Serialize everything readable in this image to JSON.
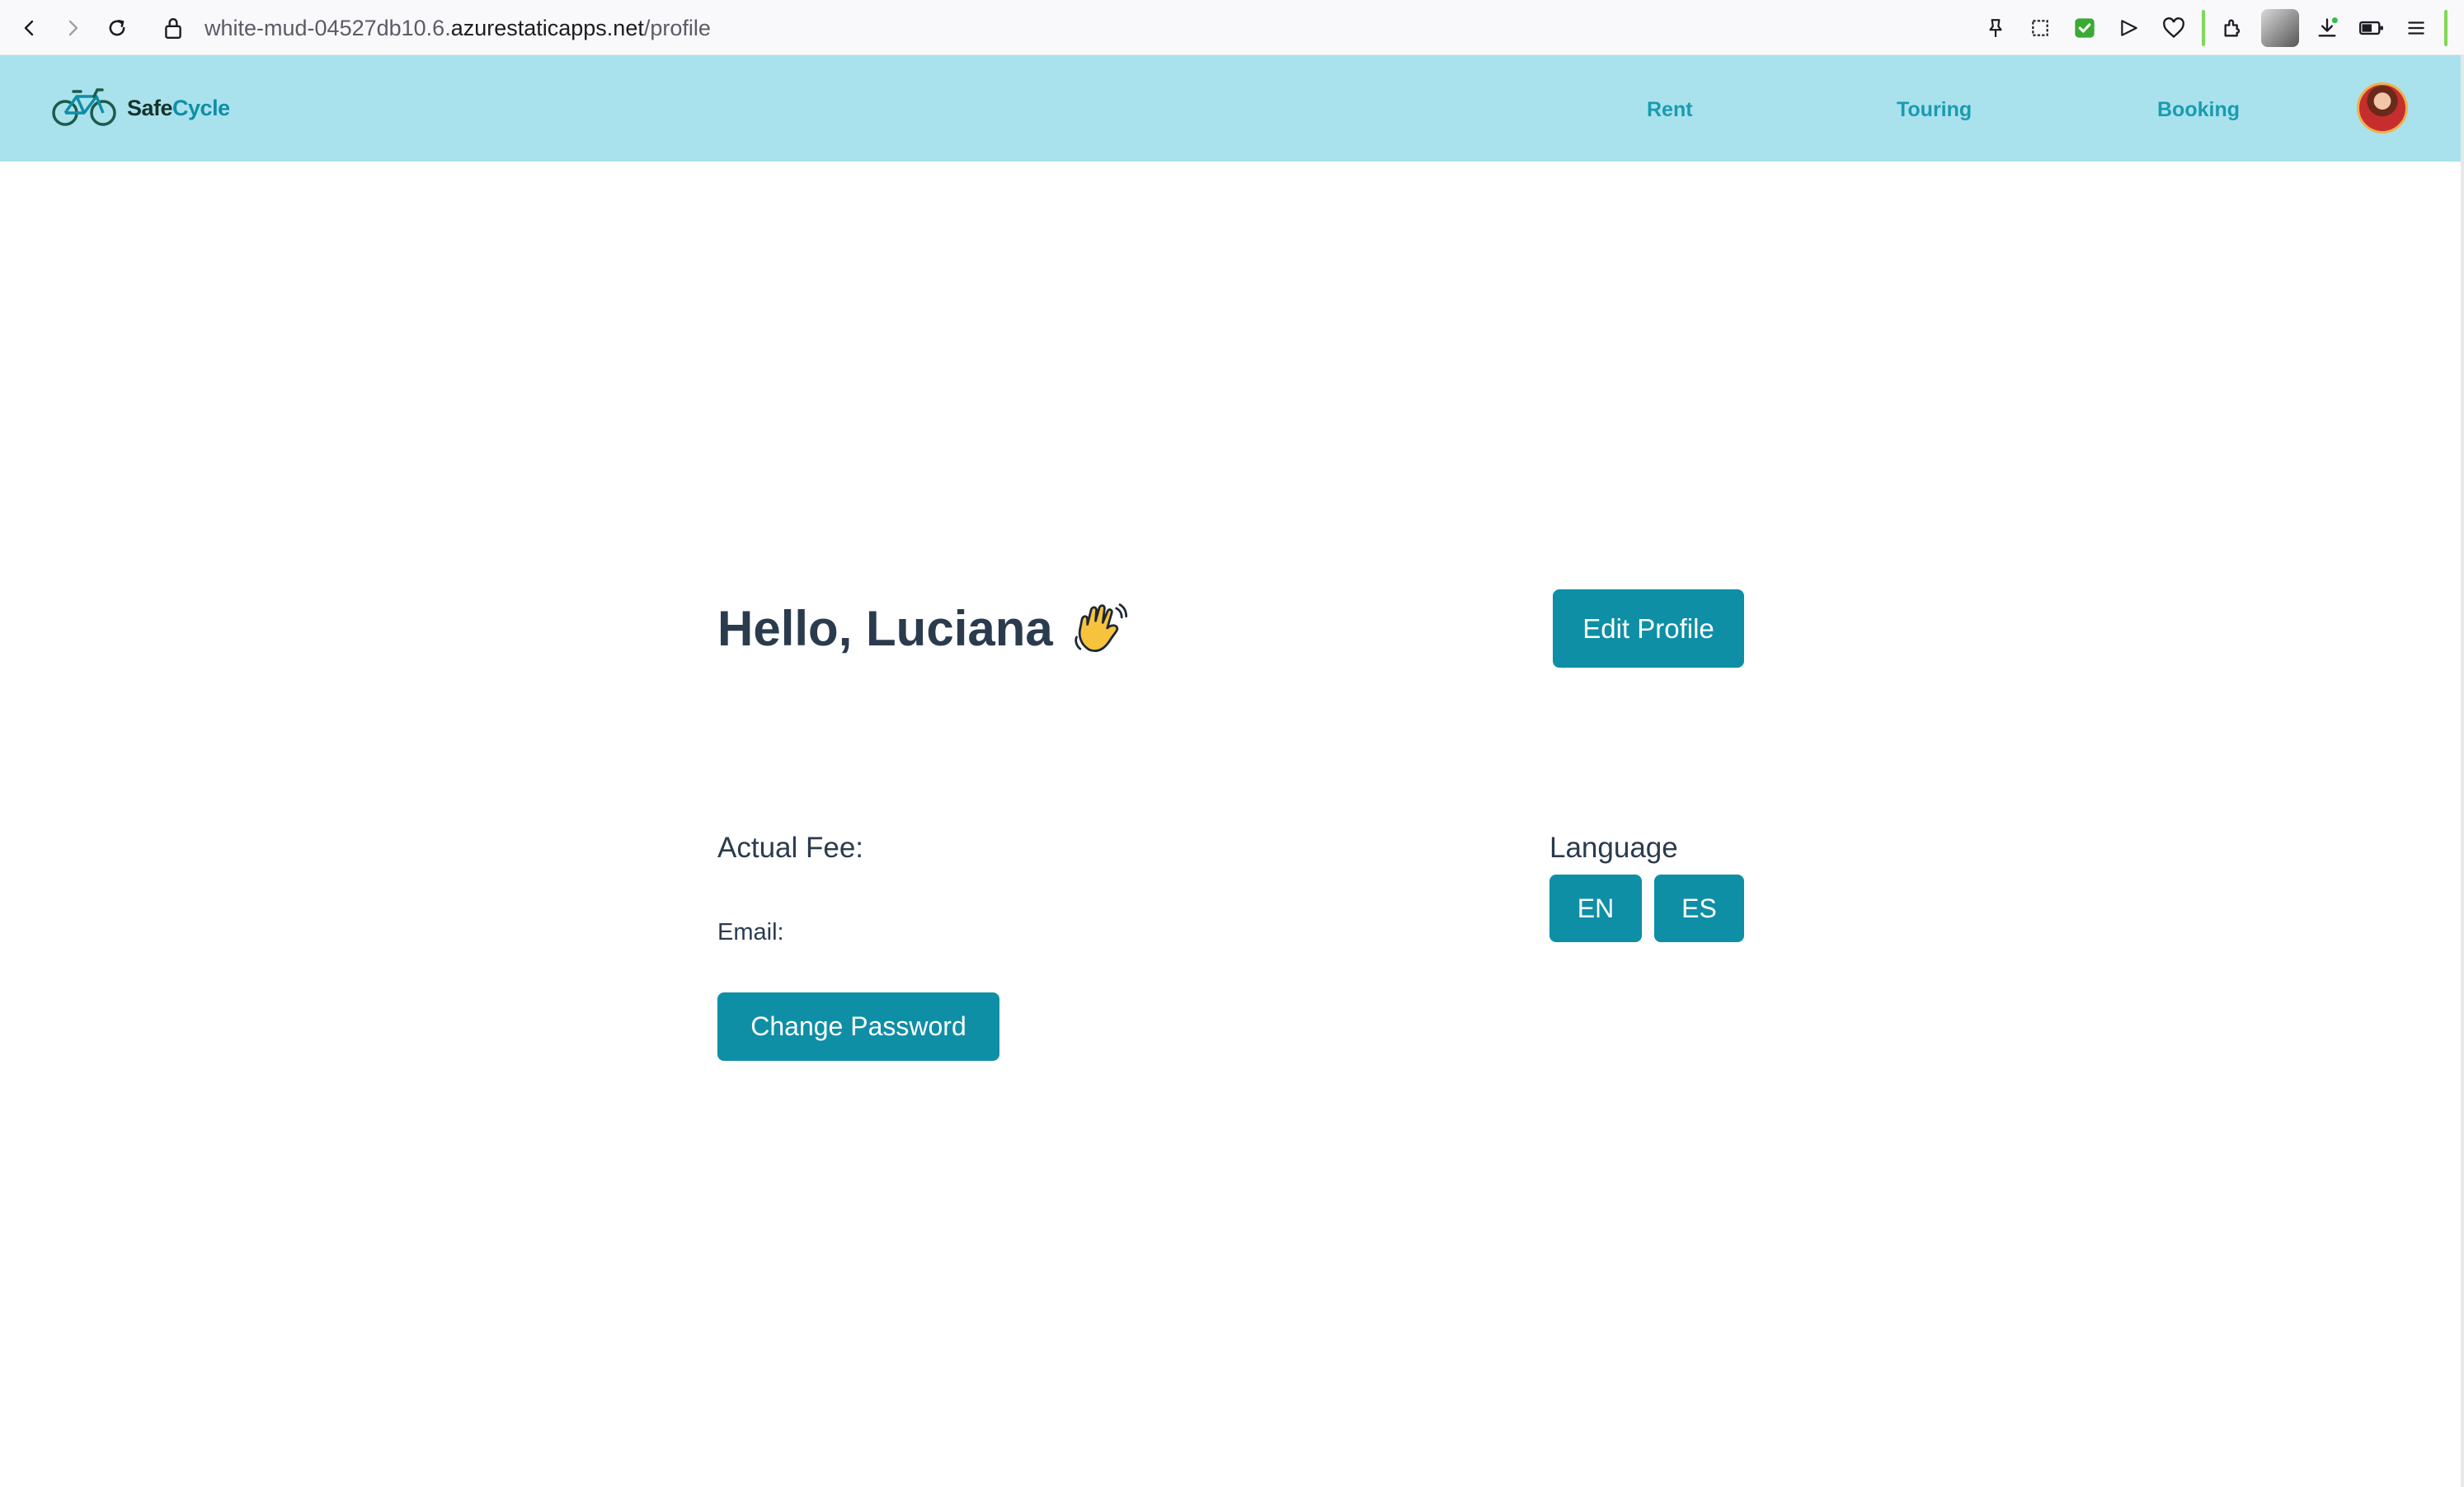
{
  "browser": {
    "url_prefix": "white-mud-04527db10.6.",
    "url_domain": "azurestaticapps.net",
    "url_path": "/profile"
  },
  "header": {
    "brand_part1": "Safe",
    "brand_part2": "Cycle",
    "nav": [
      {
        "label": "Rent"
      },
      {
        "label": "Touring"
      },
      {
        "label": "Booking"
      }
    ]
  },
  "profile": {
    "greeting": "Hello, Luciana",
    "edit_label": "Edit Profile",
    "fee_label": "Actual Fee:",
    "email_label": "Email:",
    "change_password_label": "Change Password",
    "language_label": "Language",
    "languages": [
      "EN",
      "ES"
    ]
  },
  "colors": {
    "header_bg": "#a9e2ed",
    "accent": "#0e8fa6",
    "nav_text": "#1a9bb0",
    "text": "#2b3b4e"
  },
  "icons": [
    "back-icon",
    "forward-icon",
    "reload-icon",
    "lock-icon",
    "bicycle-icon",
    "waving-hand-icon",
    "avatar"
  ]
}
